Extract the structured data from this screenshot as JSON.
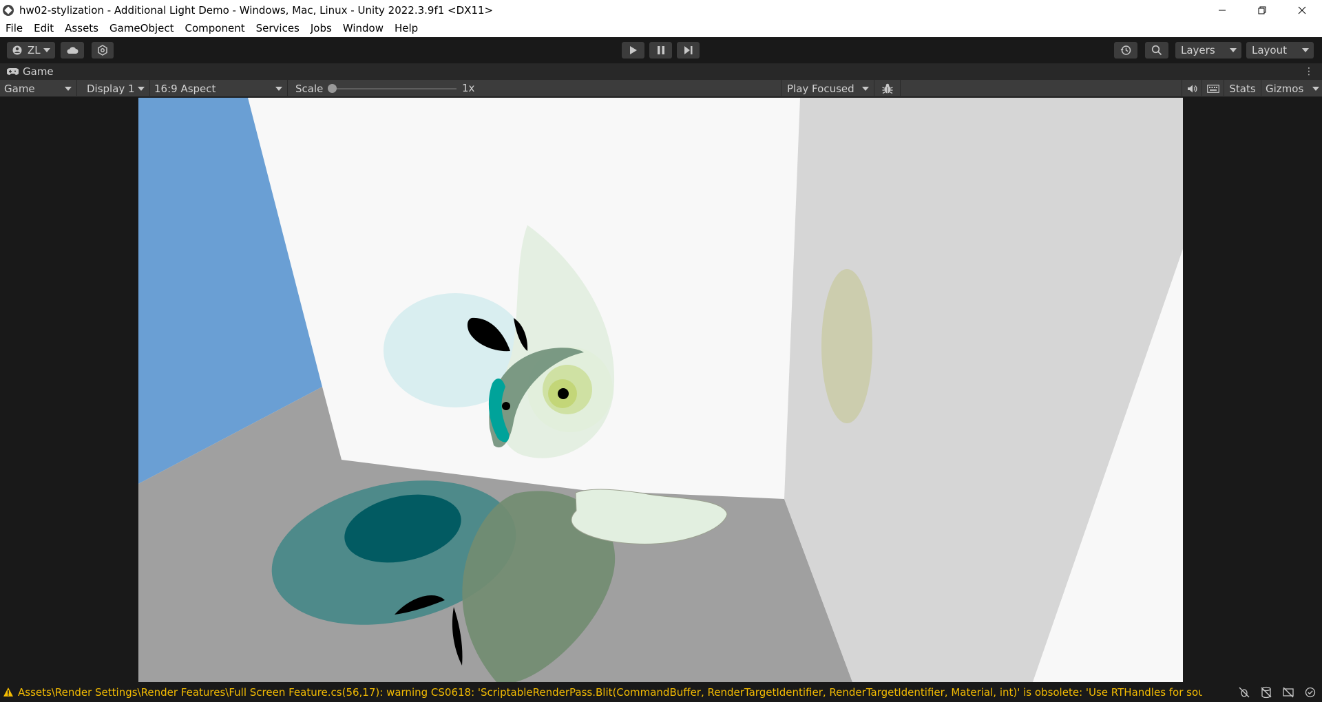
{
  "window": {
    "title": "hw02-stylization - Additional Light Demo - Windows, Mac, Linux - Unity 2022.3.9f1 <DX11>",
    "controls": [
      "minimize-icon",
      "restore-icon",
      "close-icon"
    ]
  },
  "menu": {
    "items": [
      "File",
      "Edit",
      "Assets",
      "GameObject",
      "Component",
      "Services",
      "Jobs",
      "Window",
      "Help"
    ]
  },
  "toolbar": {
    "account_label": "ZL",
    "layers_label": "Layers",
    "layout_label": "Layout"
  },
  "tab": {
    "label": "Game"
  },
  "game_toolbar": {
    "view_select": "Game",
    "display_select": "Display 1",
    "aspect_select": "16:9 Aspect",
    "scale_label": "Scale",
    "scale_value": "1x",
    "scale_level": 0,
    "play_mode_select": "Play Focused",
    "stats_label": "Stats",
    "gizmos_label": "Gizmos"
  },
  "status": {
    "message": "Assets\\Render Settings\\Render Features\\Full Screen Feature.cs(56,17): warning CS0618: 'ScriptableRenderPass.Blit(CommandBuffer, RenderTargetIdentifier, RenderTargetIdentifier, Material, int)' is obsolete: 'Use RTHandles for source and d"
  },
  "colors": {
    "title_bar": "#ffffff",
    "editor_dark": "#191919",
    "panel": "#3c3c3c",
    "warning": "#f4bc02",
    "sky_blue": "#6a9fd4",
    "floor_gray": "#a0a0a0",
    "teal": "#4e8a8a",
    "green_shadow": "#728c71"
  }
}
